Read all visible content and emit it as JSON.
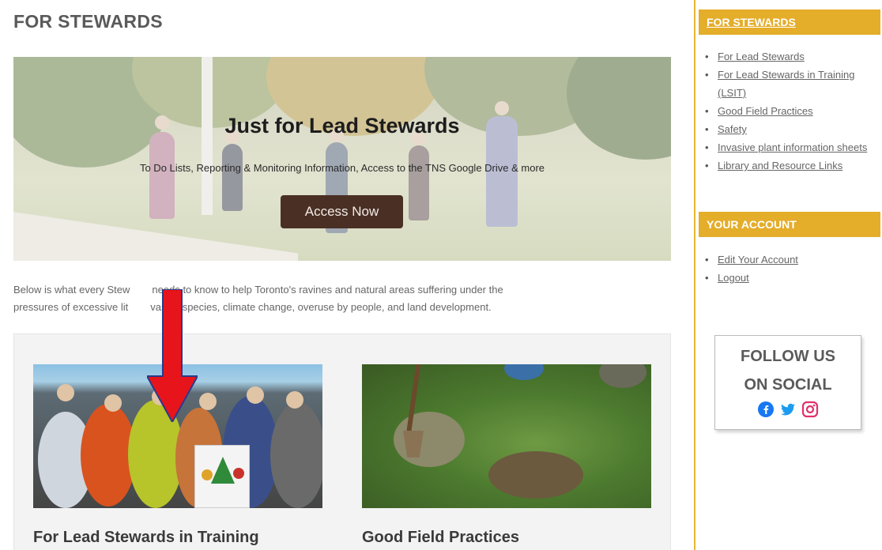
{
  "page": {
    "title": "FOR STEWARDS"
  },
  "hero": {
    "title": "Just for Lead Stewards",
    "subtitle": "To Do Lists, Reporting & Monitoring Information, Access to the TNS Google Drive & more",
    "button_label": "Access Now",
    "button_color": "#4a2f25"
  },
  "intro": {
    "line1": "Below is what every Stew",
    "line1b": "needs to know to help Toronto's ravines and natural areas suffering under the",
    "line2": "pressures of excessive lit",
    "line2b": "vasive species, climate change, overuse by people, and land development."
  },
  "cards": [
    {
      "title": "For Lead Stewards in Training"
    },
    {
      "title": "Good Field Practices"
    }
  ],
  "sidebar": {
    "section1": {
      "heading": "FOR STEWARDS",
      "links": [
        {
          "label": "For Lead Stewards"
        },
        {
          "label": "For Lead Stewards in Training (LSIT)"
        },
        {
          "label": "Good Field Practices"
        },
        {
          "label": "Safety"
        },
        {
          "label": "Invasive plant information sheets"
        },
        {
          "label": "Library and Resource Links"
        }
      ]
    },
    "section2": {
      "heading": "YOUR ACCOUNT",
      "links": [
        {
          "label": "Edit Your Account"
        },
        {
          "label": "Logout"
        }
      ]
    },
    "accent_color": "#e4ad2a"
  },
  "follow": {
    "line1": "FOLLOW US",
    "line2": "ON SOCIAL",
    "icons": [
      "facebook-icon",
      "twitter-icon",
      "instagram-icon"
    ]
  },
  "annotation": {
    "arrow_color": "#e8141c"
  }
}
